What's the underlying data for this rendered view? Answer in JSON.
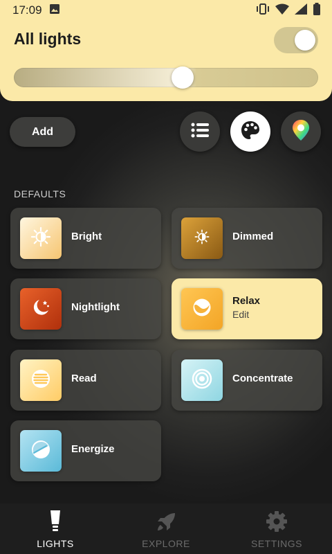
{
  "status_bar": {
    "time": "17:09"
  },
  "header": {
    "title": "All lights",
    "toggle_on": true,
    "brightness_percent": 56
  },
  "controls": {
    "add_label": "Add"
  },
  "section": {
    "label": "DEFAULTS"
  },
  "scenes": [
    {
      "label": "Bright",
      "icon": "sun-half-icon",
      "color_from": "#fff1cf",
      "color_to": "#f6c571"
    },
    {
      "label": "Dimmed",
      "icon": "sun-half-small-icon",
      "color_from": "#d99a2c",
      "color_to": "#8a5a14"
    },
    {
      "label": "Nightlight",
      "icon": "moon-stars-icon",
      "color_from": "#e35a1f",
      "color_to": "#b8300c"
    },
    {
      "label": "Relax",
      "sub": "Edit",
      "icon": "yin-yang-icon",
      "color_from": "#ffc34a",
      "color_to": "#f3a526",
      "active": true
    },
    {
      "label": "Read",
      "icon": "lines-circle-icon",
      "color_from": "#fff0b8",
      "color_to": "#ffcf6a"
    },
    {
      "label": "Concentrate",
      "icon": "target-icon",
      "color_from": "#cdf1f5",
      "color_to": "#8fd6e2"
    },
    {
      "label": "Energize",
      "icon": "gauge-icon",
      "color_from": "#a8dff0",
      "color_to": "#5bbad8"
    }
  ],
  "nav": {
    "lights": "LIGHTS",
    "explore": "EXPLORE",
    "settings": "SETTINGS"
  },
  "colors": {
    "accent": "#fbe9a8",
    "background": "#1f1f1f"
  }
}
